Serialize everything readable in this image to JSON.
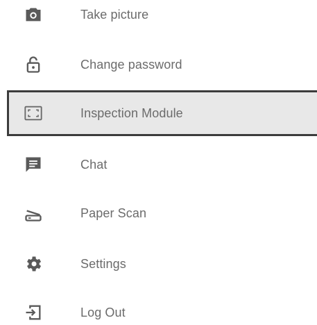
{
  "menu": {
    "items": [
      {
        "label": "Take picture",
        "icon": "camera-icon"
      },
      {
        "label": "Change password",
        "icon": "lock-icon"
      },
      {
        "label": "Inspection Module",
        "icon": "inspection-frame-icon",
        "selected": true
      },
      {
        "label": "Chat",
        "icon": "chat-icon"
      },
      {
        "label": "Paper Scan",
        "icon": "scanner-icon"
      },
      {
        "label": "Settings",
        "icon": "gear-icon"
      },
      {
        "label": "Log Out",
        "icon": "logout-icon"
      }
    ]
  },
  "colors": {
    "icon": "#5a5a5a",
    "label": "#6b6b6b",
    "selected_bg": "#e8e8e8",
    "selected_border": "#3c3c3c"
  }
}
